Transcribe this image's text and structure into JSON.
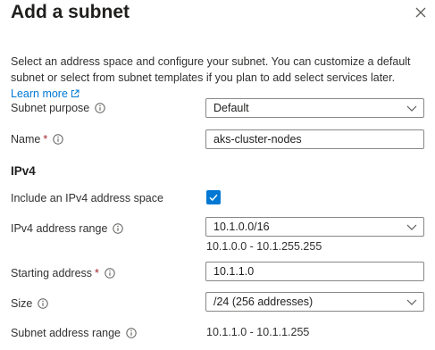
{
  "panel": {
    "title": "Add a subnet",
    "description": "Select an address space and configure your subnet. You can customize a default subnet or select from subnet templates if you plan to add select services later.",
    "learn_more": "Learn more"
  },
  "icons": {
    "close": "close-icon",
    "info": "info-icon",
    "external_link": "external-link-icon",
    "chevron": "chevron-down-icon",
    "check": "checkmark-icon"
  },
  "colors": {
    "accent": "#0078d4",
    "required": "#a4262c"
  },
  "form": {
    "subnet_purpose": {
      "label": "Subnet purpose",
      "value": "Default"
    },
    "name": {
      "label": "Name",
      "required_mark": "*",
      "value": "aks-cluster-nodes"
    },
    "ipv4_section": "IPv4",
    "include_ipv4": {
      "label": "Include an IPv4 address space",
      "checked": true
    },
    "ipv4_range": {
      "label": "IPv4 address range",
      "value": "10.1.0.0/16",
      "hint": "10.1.0.0 - 10.1.255.255"
    },
    "starting_address": {
      "label": "Starting address",
      "required_mark": "*",
      "value": "10.1.1.0"
    },
    "size": {
      "label": "Size",
      "value": "/24 (256 addresses)"
    },
    "subnet_address_range": {
      "label": "Subnet address range",
      "value": "10.1.1.0 - 10.1.1.255"
    }
  }
}
